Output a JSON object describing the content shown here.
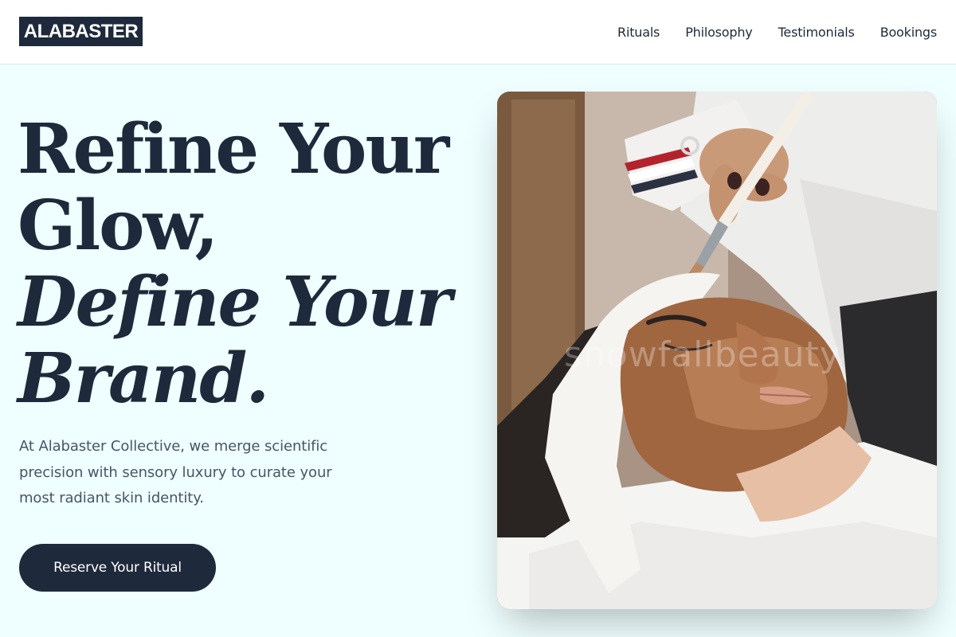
{
  "header": {
    "logo": "ALABASTER",
    "nav": [
      {
        "label": "Rituals"
      },
      {
        "label": "Philosophy"
      },
      {
        "label": "Testimonials"
      },
      {
        "label": "Bookings"
      }
    ]
  },
  "hero": {
    "headline": {
      "line1": "Refine Your",
      "line2": "Glow,",
      "line3": "Define Your",
      "line4": "Brand."
    },
    "intro": "At Alabaster Collective, we merge scientific precision with sensory luxury to curate your most radiant skin identity.",
    "cta_label": "Reserve Your Ritual",
    "image": {
      "subject": "facial-treatment-photo",
      "watermark": "snowfallbeauty"
    }
  },
  "colors": {
    "navy": "#1e293b",
    "page_bg": "#effefe",
    "body_text": "#475569"
  }
}
